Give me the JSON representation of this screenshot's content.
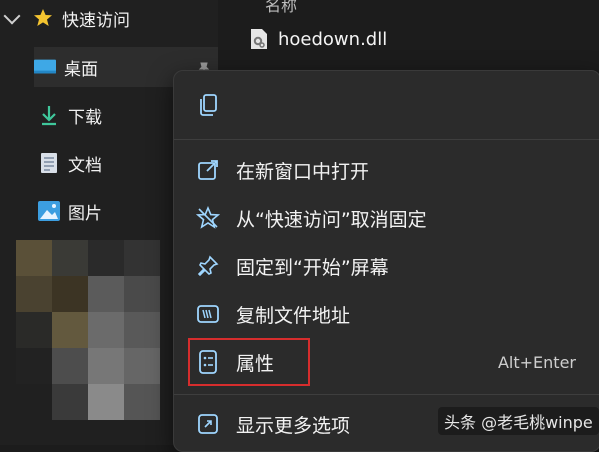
{
  "sidebar": {
    "quick_access": "快速访问",
    "items": [
      {
        "label": "桌面",
        "icon": "desktop-icon"
      },
      {
        "label": "下载",
        "icon": "download-icon"
      },
      {
        "label": "文档",
        "icon": "document-icon"
      },
      {
        "label": "图片",
        "icon": "pictures-icon"
      }
    ]
  },
  "file_list": {
    "column_header": "名称",
    "files": [
      {
        "name": "hoedown.dll",
        "icon": "dll-file-icon"
      }
    ]
  },
  "context_menu": {
    "top_actions": [
      {
        "icon": "copy-icon"
      }
    ],
    "items": [
      {
        "label": "在新窗口中打开",
        "icon": "open-new-window-icon"
      },
      {
        "label": "从“快速访问”取消固定",
        "icon": "unpin-icon"
      },
      {
        "label": "固定到“开始”屏幕",
        "icon": "pin-icon"
      },
      {
        "label": "复制文件地址",
        "icon": "copy-path-icon"
      },
      {
        "label": "属性",
        "icon": "properties-icon",
        "shortcut": "Alt+Enter"
      },
      {
        "label": "显示更多选项",
        "icon": "more-options-icon"
      }
    ]
  },
  "watermark": "头条 @老毛桃winpe",
  "colors": {
    "accent": "#4cc2ff",
    "highlight_border": "#d62d2d",
    "menu_bg": "#2b2b2b"
  }
}
